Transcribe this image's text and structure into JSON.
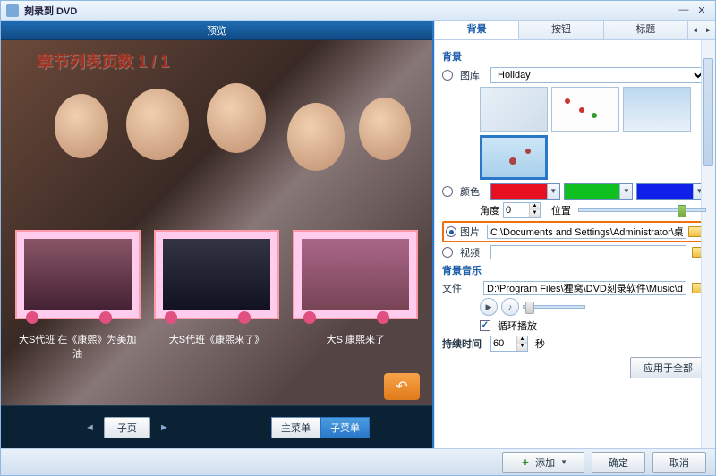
{
  "title": "刻录到 DVD",
  "preview": {
    "header": "预览",
    "chapter_text": "章节列表页数 1 / 1",
    "thumbs": [
      {
        "caption": "大S代班 在《康煕》为美加油"
      },
      {
        "caption": "大S代班《康煕来了》"
      },
      {
        "caption": "大S 康煕来了"
      }
    ],
    "nav_sub": "子页",
    "menu_main": "主菜单",
    "menu_sub": "子菜单"
  },
  "tabs": {
    "bg": "背景",
    "button": "按钮",
    "title": "标题"
  },
  "panel": {
    "bg_section": "背景",
    "library_label": "图库",
    "library_value": "Holiday",
    "color_label": "颜色",
    "angle_label": "角度",
    "angle_value": "0",
    "position_label": "位置",
    "image_label": "图片",
    "image_path": "C:\\Documents and Settings\\Administrator\\桌面",
    "video_label": "视频",
    "music_section": "背景音乐",
    "file_label": "文件",
    "file_path": "D:\\Program Files\\狸窝\\DVD刻录软件\\Music\\defa",
    "loop_label": "循环播放",
    "duration_label": "持续时间",
    "duration_value": "60",
    "duration_unit": "秒",
    "apply_all": "应用于全部"
  },
  "bottom": {
    "add": "添加",
    "ok": "确定",
    "cancel": "取消"
  }
}
